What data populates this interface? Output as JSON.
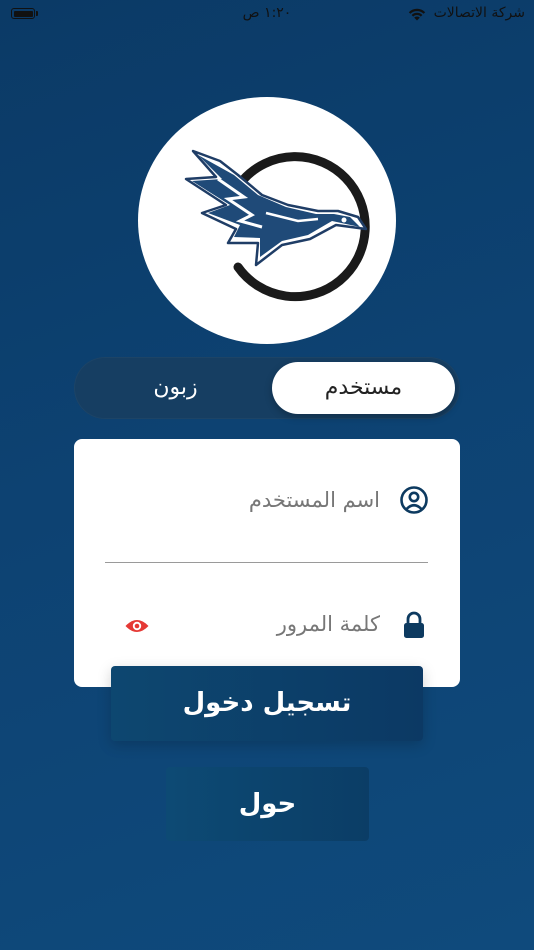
{
  "status_bar": {
    "carrier": "شركة الاتصالات",
    "time": "١:٢٠ ص",
    "icons": [
      "wifi-icon",
      "battery-icon"
    ]
  },
  "logo": {
    "name": "eagle-logo"
  },
  "segmented": {
    "options": [
      "مستخدم",
      "زبون"
    ],
    "selected": "مستخدم"
  },
  "form": {
    "username_placeholder": "اسم المستخدم",
    "password_placeholder": "كلمة المرور",
    "icons": [
      "user-circle-icon",
      "lock-icon",
      "eye-icon"
    ]
  },
  "buttons": {
    "login": "تسجيل دخول",
    "about": "حول"
  },
  "colors": {
    "background": "#0d4272",
    "accent_eye": "#e53935",
    "card": "#ffffff"
  }
}
